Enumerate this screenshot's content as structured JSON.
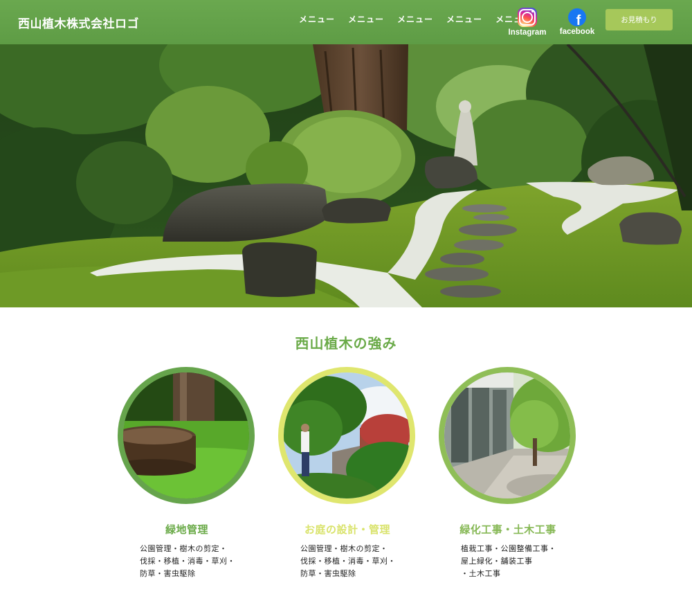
{
  "header": {
    "logo": "西山植木株式会社ロゴ",
    "nav": [
      "メニュー",
      "メニュー",
      "メニュー",
      "メニュー",
      "メニュー"
    ],
    "social": [
      {
        "label": "Instagram",
        "icon": "instagram-icon"
      },
      {
        "label": "facebook",
        "icon": "facebook-icon"
      }
    ],
    "estimate_button": "お見積もり",
    "bg_color": "#66a44c"
  },
  "hero": {
    "image": "japanese-garden-photo"
  },
  "strengths": {
    "title": "西山植木の強み",
    "cards": [
      {
        "title": "緑地管理",
        "title_color": "#6aaa48",
        "ring_color": "#66a44c",
        "lines": [
          "公園管理・樹木の剪定・",
          "伐採・移植・消毒・草刈・",
          "防草・害虫駆除"
        ]
      },
      {
        "title": "お庭の設計・管理",
        "title_color": "#d9e36b",
        "ring_color": "#dfe66e",
        "lines": [
          "公園管理・樹木の剪定・",
          "伐採・移植・消毒・草刈・",
          "防草・害虫駆除"
        ]
      },
      {
        "title": "緑化工事・土木工事",
        "title_color": "#86b855",
        "ring_color": "#8fbe57",
        "lines": [
          "植栽工事・公園整備工事・",
          "屋上緑化・舗装工事",
          "・土木工事"
        ]
      }
    ]
  }
}
